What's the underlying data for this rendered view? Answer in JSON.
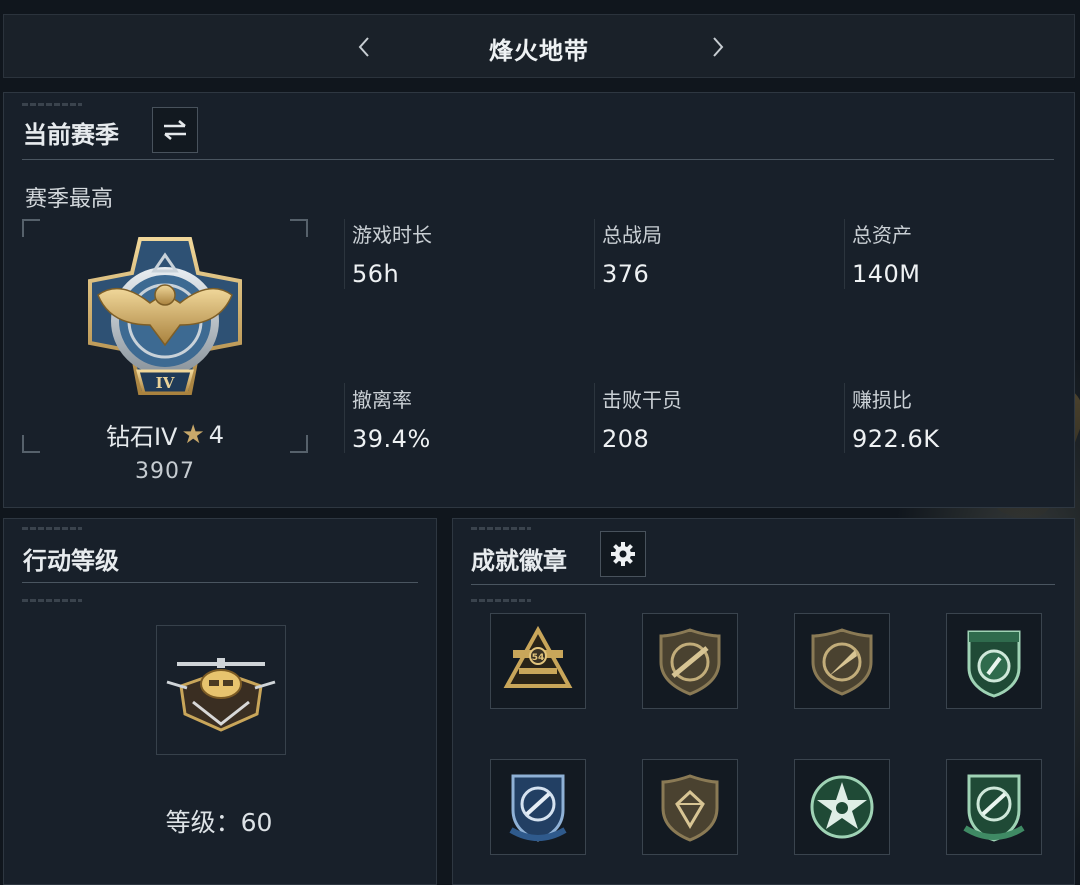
{
  "header": {
    "title": "烽火地带",
    "prev_icon": "chevron-left-icon",
    "next_icon": "chevron-right-icon"
  },
  "season": {
    "title": "当前赛季",
    "switch_icon": "swap-icon",
    "subtitle": "赛季最高",
    "rank": {
      "name": "钻石IV",
      "stars": "4",
      "score": "3907",
      "emblem_icon": "diamond-eagle-emblem-icon",
      "tier_numeral": "IV"
    },
    "stats": [
      {
        "label": "游戏时长",
        "value": "56h"
      },
      {
        "label": "总战局",
        "value": "376"
      },
      {
        "label": "总资产",
        "value": "140M"
      },
      {
        "label": "撤离率",
        "value": "39.4%"
      },
      {
        "label": "击败干员",
        "value": "208"
      },
      {
        "label": "赚损比",
        "value": "922.6K"
      }
    ]
  },
  "level": {
    "title": "行动等级",
    "badge_icon": "helicopter-badge-icon",
    "text": "等级：60"
  },
  "achievements": {
    "title": "成就徽章",
    "settings_icon": "gear-icon",
    "badges": [
      {
        "icon": "gold-54-badge-icon",
        "tone": "#c9a65a"
      },
      {
        "icon": "rifle-shield-badge-icon",
        "tone": "#8a7a55"
      },
      {
        "icon": "knife-shield-badge-icon",
        "tone": "#8a7a55"
      },
      {
        "icon": "green-missile-badge-icon",
        "tone": "#3f8a64"
      },
      {
        "icon": "blue-missile-badge-icon",
        "tone": "#2f5a8c"
      },
      {
        "icon": "diamond-shield-badge-icon",
        "tone": "#8a7a55"
      },
      {
        "icon": "green-star-badge-icon",
        "tone": "#3f8a64"
      },
      {
        "icon": "green-rocket-badge-icon",
        "tone": "#3f8a64"
      }
    ]
  },
  "colors": {
    "gold": "#c8a86a",
    "bronze": "#8a7a55",
    "green": "#3f8a64",
    "blue": "#2f5a8c"
  }
}
